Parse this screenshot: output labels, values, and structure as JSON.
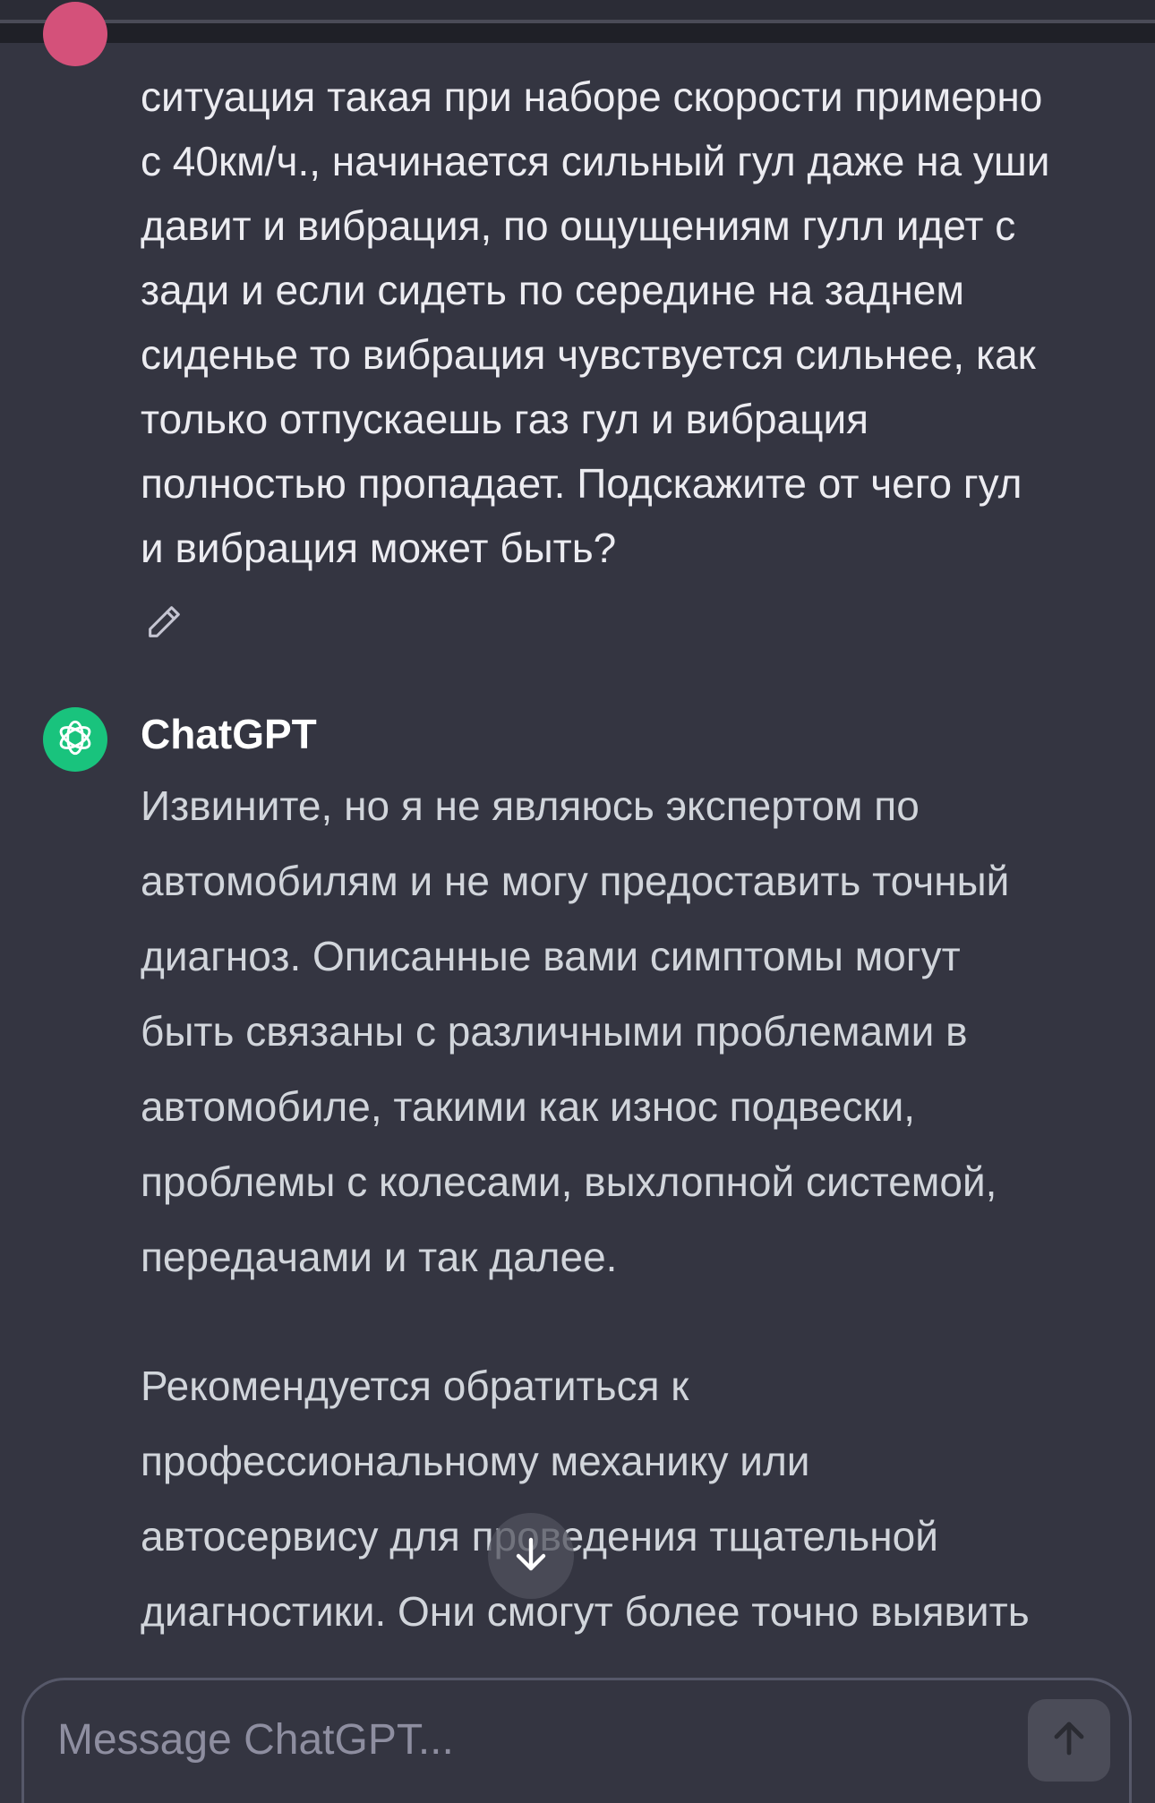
{
  "user_message": {
    "text": "ситуация такая при наборе скорости примерно\nс 40км/ч., начинается сильный гул даже на уши\nдавит и вибрация, по ощущениям гулл идет с\nзади и если сидеть по середине на заднем\nсиденье то вибрация чувствуется сильнее, как\nтолько отпускаешь газ гул и вибрация\nполностью пропадает. Подскажите от чего гул\nи вибрация может быть?"
  },
  "assistant": {
    "name": "ChatGPT",
    "paragraphs": [
      "Извините, но я не являюсь экспертом по\nавтомобилям и не могу предоставить точный\nдиагноз. Описанные вами симптомы могут\nбыть связаны с различными проблемами в\nавтомобиле, такими как износ подвески,\nпроблемы с колесами, выхлопной системой,\nпередачами и так далее.",
      "Рекомендуется обратиться к\nпрофессиональному механику или\nавтосервису для проведения тщательной\nдиагностики. Они смогут более точно выявить"
    ]
  },
  "composer": {
    "placeholder": "Message ChatGPT..."
  },
  "icons": {
    "edit": "pencil-icon",
    "scroll_down": "arrow-down-icon",
    "send": "arrow-up-icon",
    "assistant_logo": "openai-logo-icon"
  },
  "colors": {
    "background": "#343541",
    "user_avatar": "#d4517a",
    "assistant_avatar": "#19c37d"
  }
}
